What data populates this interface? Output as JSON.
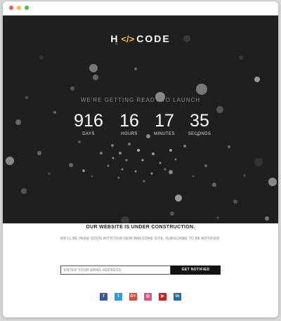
{
  "window": {
    "controls": [
      "close",
      "minimize",
      "maximize"
    ]
  },
  "logo": {
    "left": "H",
    "icon": "</>",
    "right": "CODE"
  },
  "tagline": "WE'RE GETTING READY TO LAUNCH",
  "countdown": [
    {
      "value": "916",
      "label": "DAYS"
    },
    {
      "value": "16",
      "label": "HOURS"
    },
    {
      "value": "17",
      "label": "MINUTES"
    },
    {
      "value": "35",
      "label": "SECONDS"
    }
  ],
  "headline": "OUR WEBSITE IS UNDER CONSTRUCTION.",
  "subheadline": "WE'LL BE HERE SOON WITH OUR NEW AWESOME SITE, SUBSCRIBE TO BE NOTIFIED.",
  "email": {
    "placeholder": "ENTER YOUR EMAIL ADDRESS"
  },
  "notify_button": "GET NOTIFIED",
  "social": [
    {
      "icon": "facebook-icon",
      "glyph": "f",
      "color": "#3b5998"
    },
    {
      "icon": "twitter-icon",
      "glyph": "t",
      "color": "#1da1f2"
    },
    {
      "icon": "google-plus-icon",
      "glyph": "G+",
      "color": "#dd4b39"
    },
    {
      "icon": "dribbble-icon",
      "glyph": "◎",
      "color": "#e94f8c"
    },
    {
      "icon": "youtube-icon",
      "glyph": "▶",
      "color": "#cd201f"
    },
    {
      "icon": "linkedin-icon",
      "glyph": "in",
      "color": "#1b6fb3"
    }
  ],
  "colors": {
    "accent": "#f0b62a",
    "hero_bg": "#1f1f1f",
    "button_bg": "#111111"
  }
}
